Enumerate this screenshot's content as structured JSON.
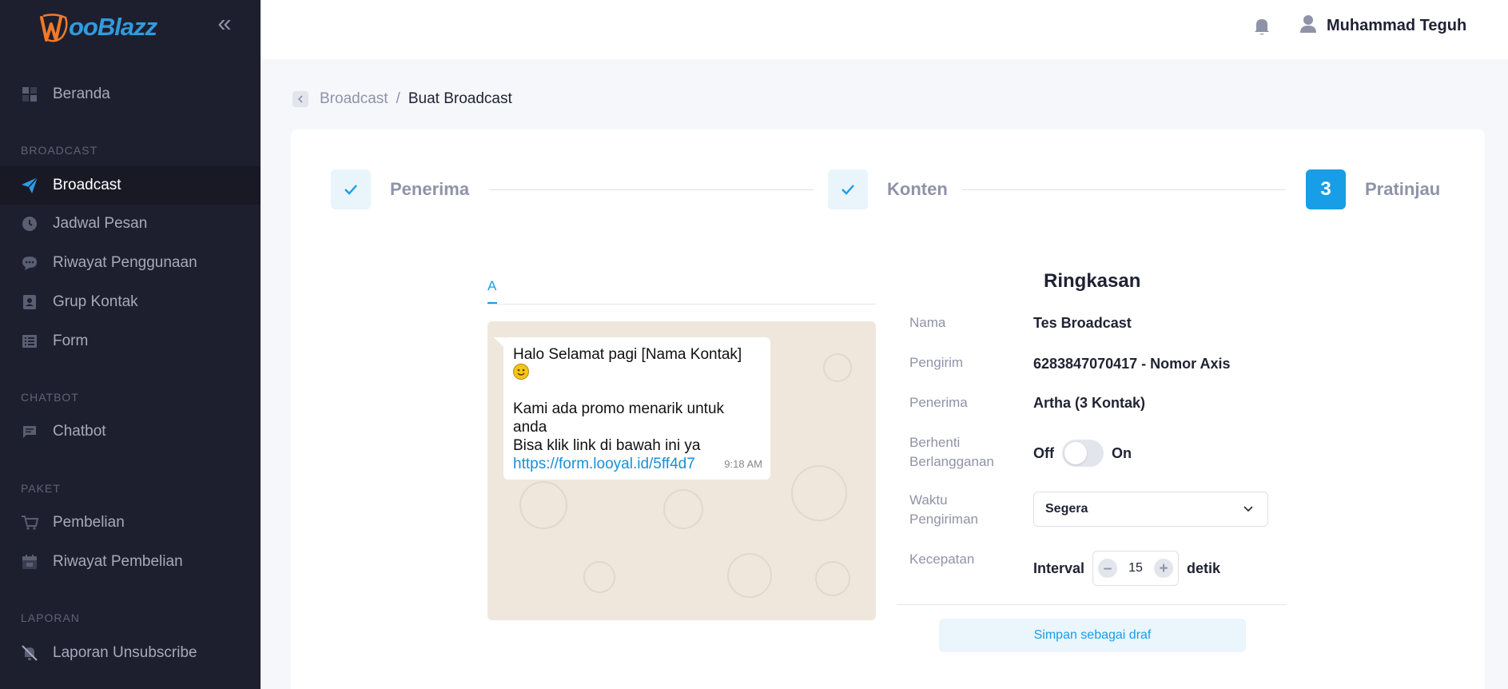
{
  "app": {
    "logo_text": "ooBlazz",
    "colors": {
      "accent": "#189ee6",
      "sidebar": "#1e1f2e",
      "logo_orange": "#f07a2a"
    }
  },
  "sidebar": {
    "collapse_label": "«",
    "items": [
      {
        "label": "Beranda",
        "icon": "dashboard-icon"
      },
      {
        "label": "Broadcast",
        "icon": "paper-plane-icon",
        "active": true
      },
      {
        "label": "Jadwal Pesan",
        "icon": "clock-icon"
      },
      {
        "label": "Riwayat Penggunaan",
        "icon": "chat-bubble-icon"
      },
      {
        "label": "Grup Kontak",
        "icon": "contact-book-icon"
      },
      {
        "label": "Form",
        "icon": "form-list-icon"
      },
      {
        "label": "Chatbot",
        "icon": "chatbot-icon"
      },
      {
        "label": "Pembelian",
        "icon": "cart-icon"
      },
      {
        "label": "Riwayat Pembelian",
        "icon": "calendar-icon"
      },
      {
        "label": "Laporan Unsubscribe",
        "icon": "bell-off-icon"
      }
    ],
    "sections": [
      "BROADCAST",
      "CHATBOT",
      "PAKET",
      "LAPORAN"
    ]
  },
  "topbar": {
    "user_name": "Muhammad Teguh"
  },
  "breadcrumb": {
    "parent": "Broadcast",
    "separator": "/",
    "current": "Buat Broadcast"
  },
  "stepper": {
    "steps": [
      {
        "label": "Penerima",
        "state": "done"
      },
      {
        "label": "Konten",
        "state": "done"
      },
      {
        "label": "Pratinjau",
        "state": "current",
        "number": "3"
      }
    ]
  },
  "preview": {
    "tab": "A",
    "message": {
      "line1": "Halo Selamat pagi [Nama Kontak]",
      "line2": "Kami ada promo menarik untuk anda",
      "line3": "Bisa klik link di bawah ini ya",
      "link": "https://form.looyal.id/5ff4d7",
      "time": "9:18 AM"
    }
  },
  "summary": {
    "title": "Ringkasan",
    "name_label": "Nama",
    "name_value": "Tes Broadcast",
    "sender_label": "Pengirim",
    "sender_value": "6283847070417 - Nomor Axis",
    "recipient_label": "Penerima",
    "recipient_value": "Artha (3 Kontak)",
    "unsub_label_1": "Berhenti",
    "unsub_label_2": "Berlangganan",
    "toggle_off": "Off",
    "toggle_on": "On",
    "send_time_label_1": "Waktu",
    "send_time_label_2": "Pengiriman",
    "send_time_value": "Segera",
    "speed_label": "Kecepatan",
    "interval_label": "Interval",
    "interval_value": "15",
    "interval_unit": "detik",
    "draft_button": "Simpan sebagai draf"
  }
}
